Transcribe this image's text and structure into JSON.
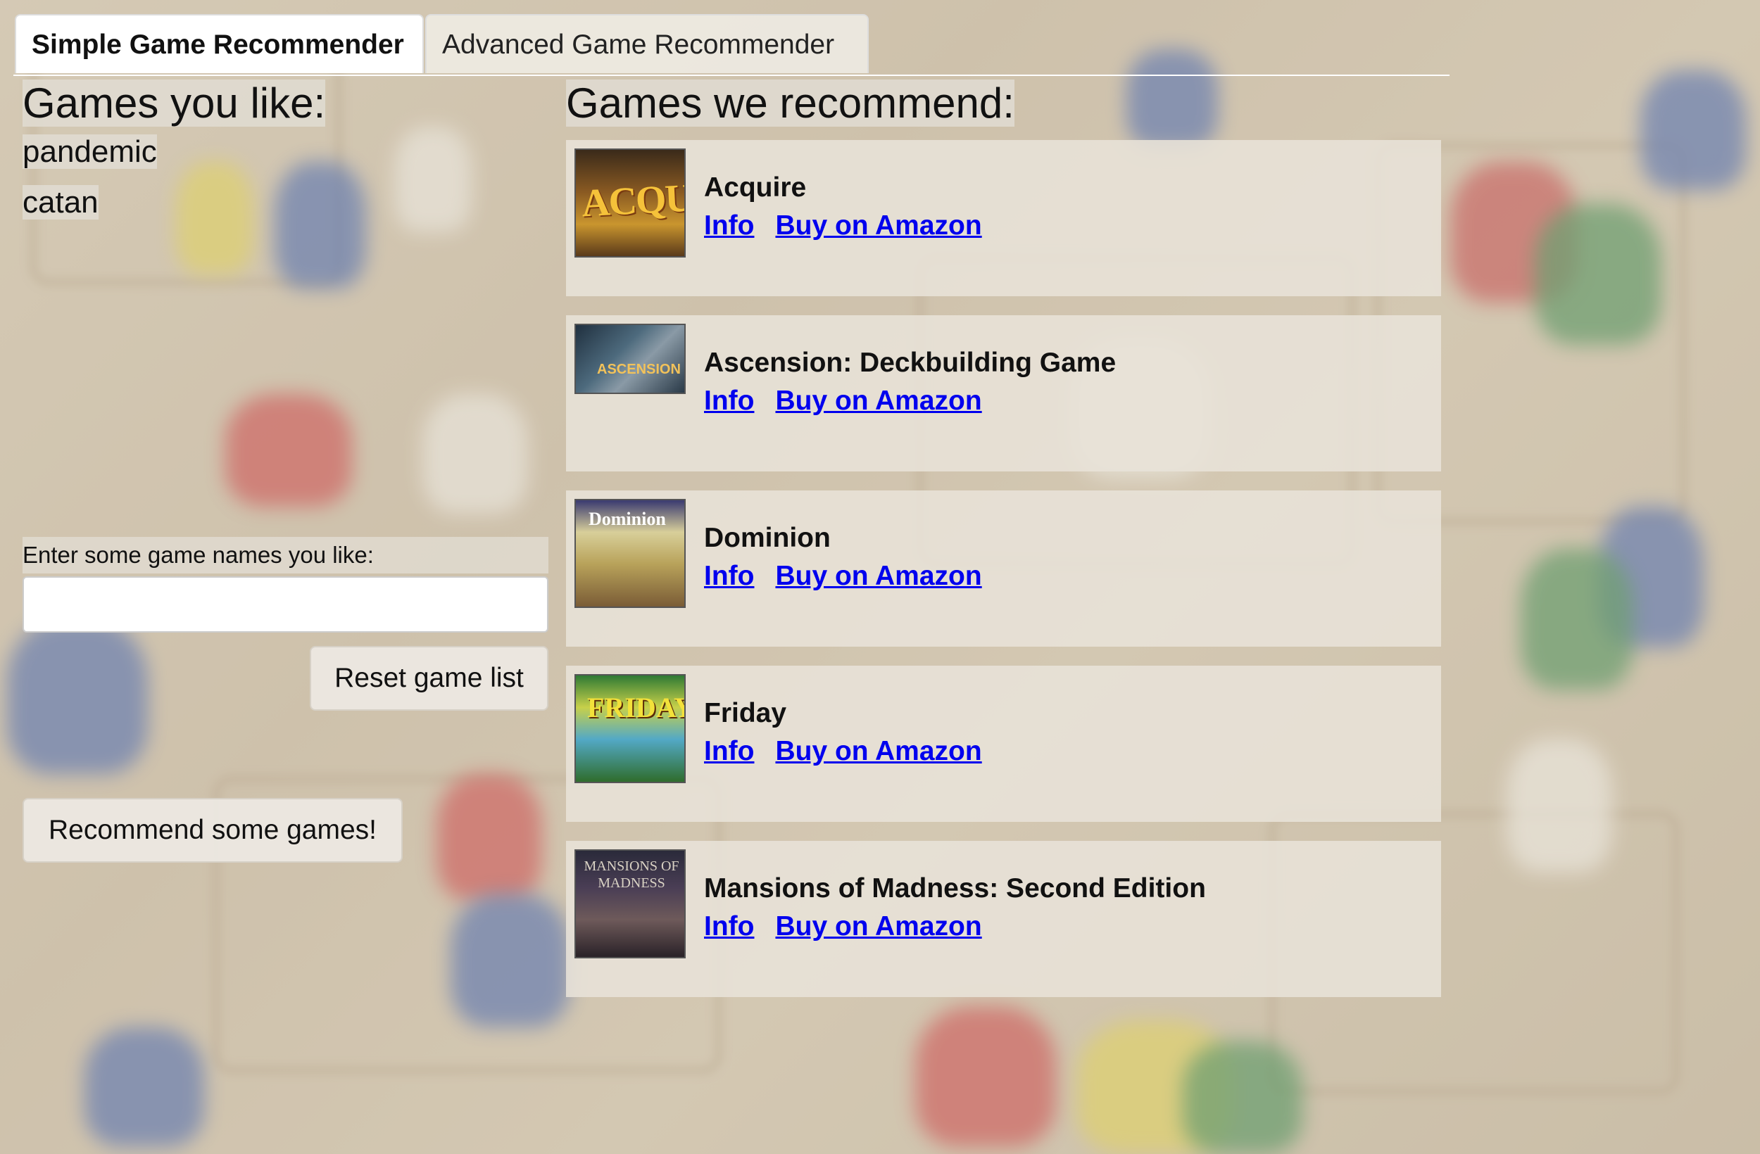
{
  "tabs": [
    {
      "label": "Simple Game Recommender",
      "active": true
    },
    {
      "label": "Advanced Game Recommender",
      "active": false
    }
  ],
  "left": {
    "title": "Games you like:",
    "liked_games": [
      "pandemic",
      "catan"
    ],
    "input_label": "Enter some game names you like:",
    "input_value": "",
    "reset_label": "Reset game list",
    "recommend_label": "Recommend some games!"
  },
  "right": {
    "title": "Games we recommend:",
    "info_label": "Info",
    "buy_label": "Buy on Amazon",
    "games": [
      {
        "name": "Acquire",
        "art": "ACQUIRE"
      },
      {
        "name": "Ascension: Deckbuilding Game",
        "art": "ASCENSION"
      },
      {
        "name": "Dominion",
        "art": "Dominion"
      },
      {
        "name": "Friday",
        "art": "FRIDAY"
      },
      {
        "name": "Mansions of Madness: Second Edition",
        "art": "MANSIONS OF MADNESS"
      }
    ]
  },
  "colors": {
    "link": "#0000ee",
    "active_tab": "#ffffff"
  }
}
